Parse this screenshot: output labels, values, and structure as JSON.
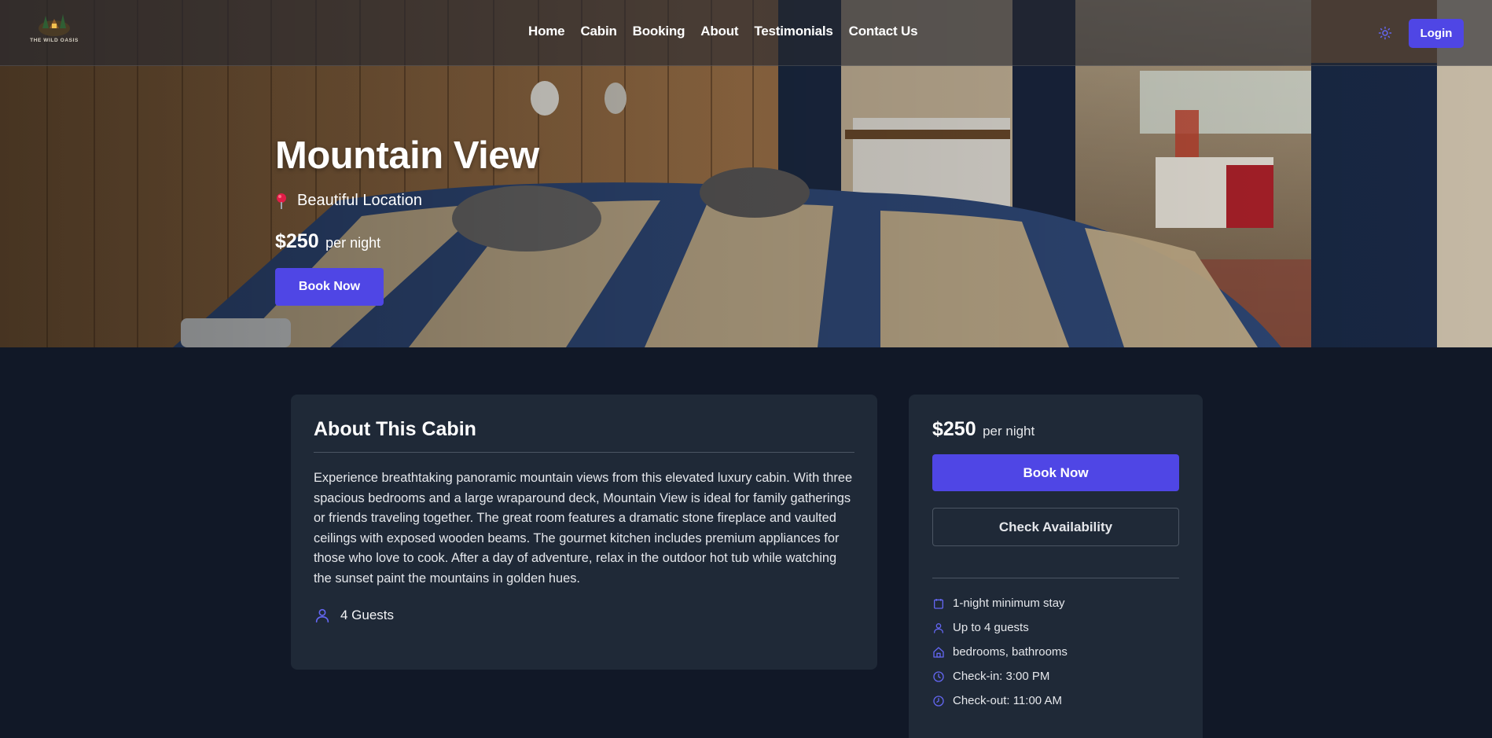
{
  "header": {
    "logo_text": "THE WILD OASIS",
    "nav": [
      {
        "label": "Home"
      },
      {
        "label": "Cabin"
      },
      {
        "label": "Booking"
      },
      {
        "label": "About"
      },
      {
        "label": "Testimonials"
      },
      {
        "label": "Contact Us"
      }
    ],
    "theme_toggle_icon": "sun-icon",
    "login_label": "Login"
  },
  "hero": {
    "title": "Mountain View",
    "location_icon": "map-pin-icon",
    "location": "Beautiful Location",
    "price": "$250",
    "price_unit": "per night",
    "book_label": "Book Now"
  },
  "about": {
    "title": "About This Cabin",
    "description": "Experience breathtaking panoramic mountain views from this elevated luxury cabin. With three spacious bedrooms and a large wraparound deck, Mountain View is ideal for family gatherings or friends traveling together. The great room features a dramatic stone fireplace and vaulted ceilings with exposed wooden beams. The gourmet kitchen includes premium appliances for those who love to cook. After a day of adventure, relax in the outdoor hot tub while watching the sunset paint the mountains in golden hues.",
    "guests_icon": "user-icon",
    "guests": "4 Guests"
  },
  "booking": {
    "price": "$250",
    "price_unit": "per night",
    "book_label": "Book Now",
    "check_label": "Check Availability",
    "details": [
      {
        "icon": "calendar-icon",
        "text": "1-night minimum stay"
      },
      {
        "icon": "user-icon",
        "text": "Up to 4 guests"
      },
      {
        "icon": "home-icon",
        "text": "bedrooms, bathrooms"
      },
      {
        "icon": "clock-icon",
        "text": "Check-in: 3:00 PM"
      },
      {
        "icon": "clock-icon",
        "text": "Check-out: 11:00 AM"
      }
    ]
  },
  "colors": {
    "accent": "#4f46e5",
    "background": "#111827",
    "card": "#1f2937"
  }
}
